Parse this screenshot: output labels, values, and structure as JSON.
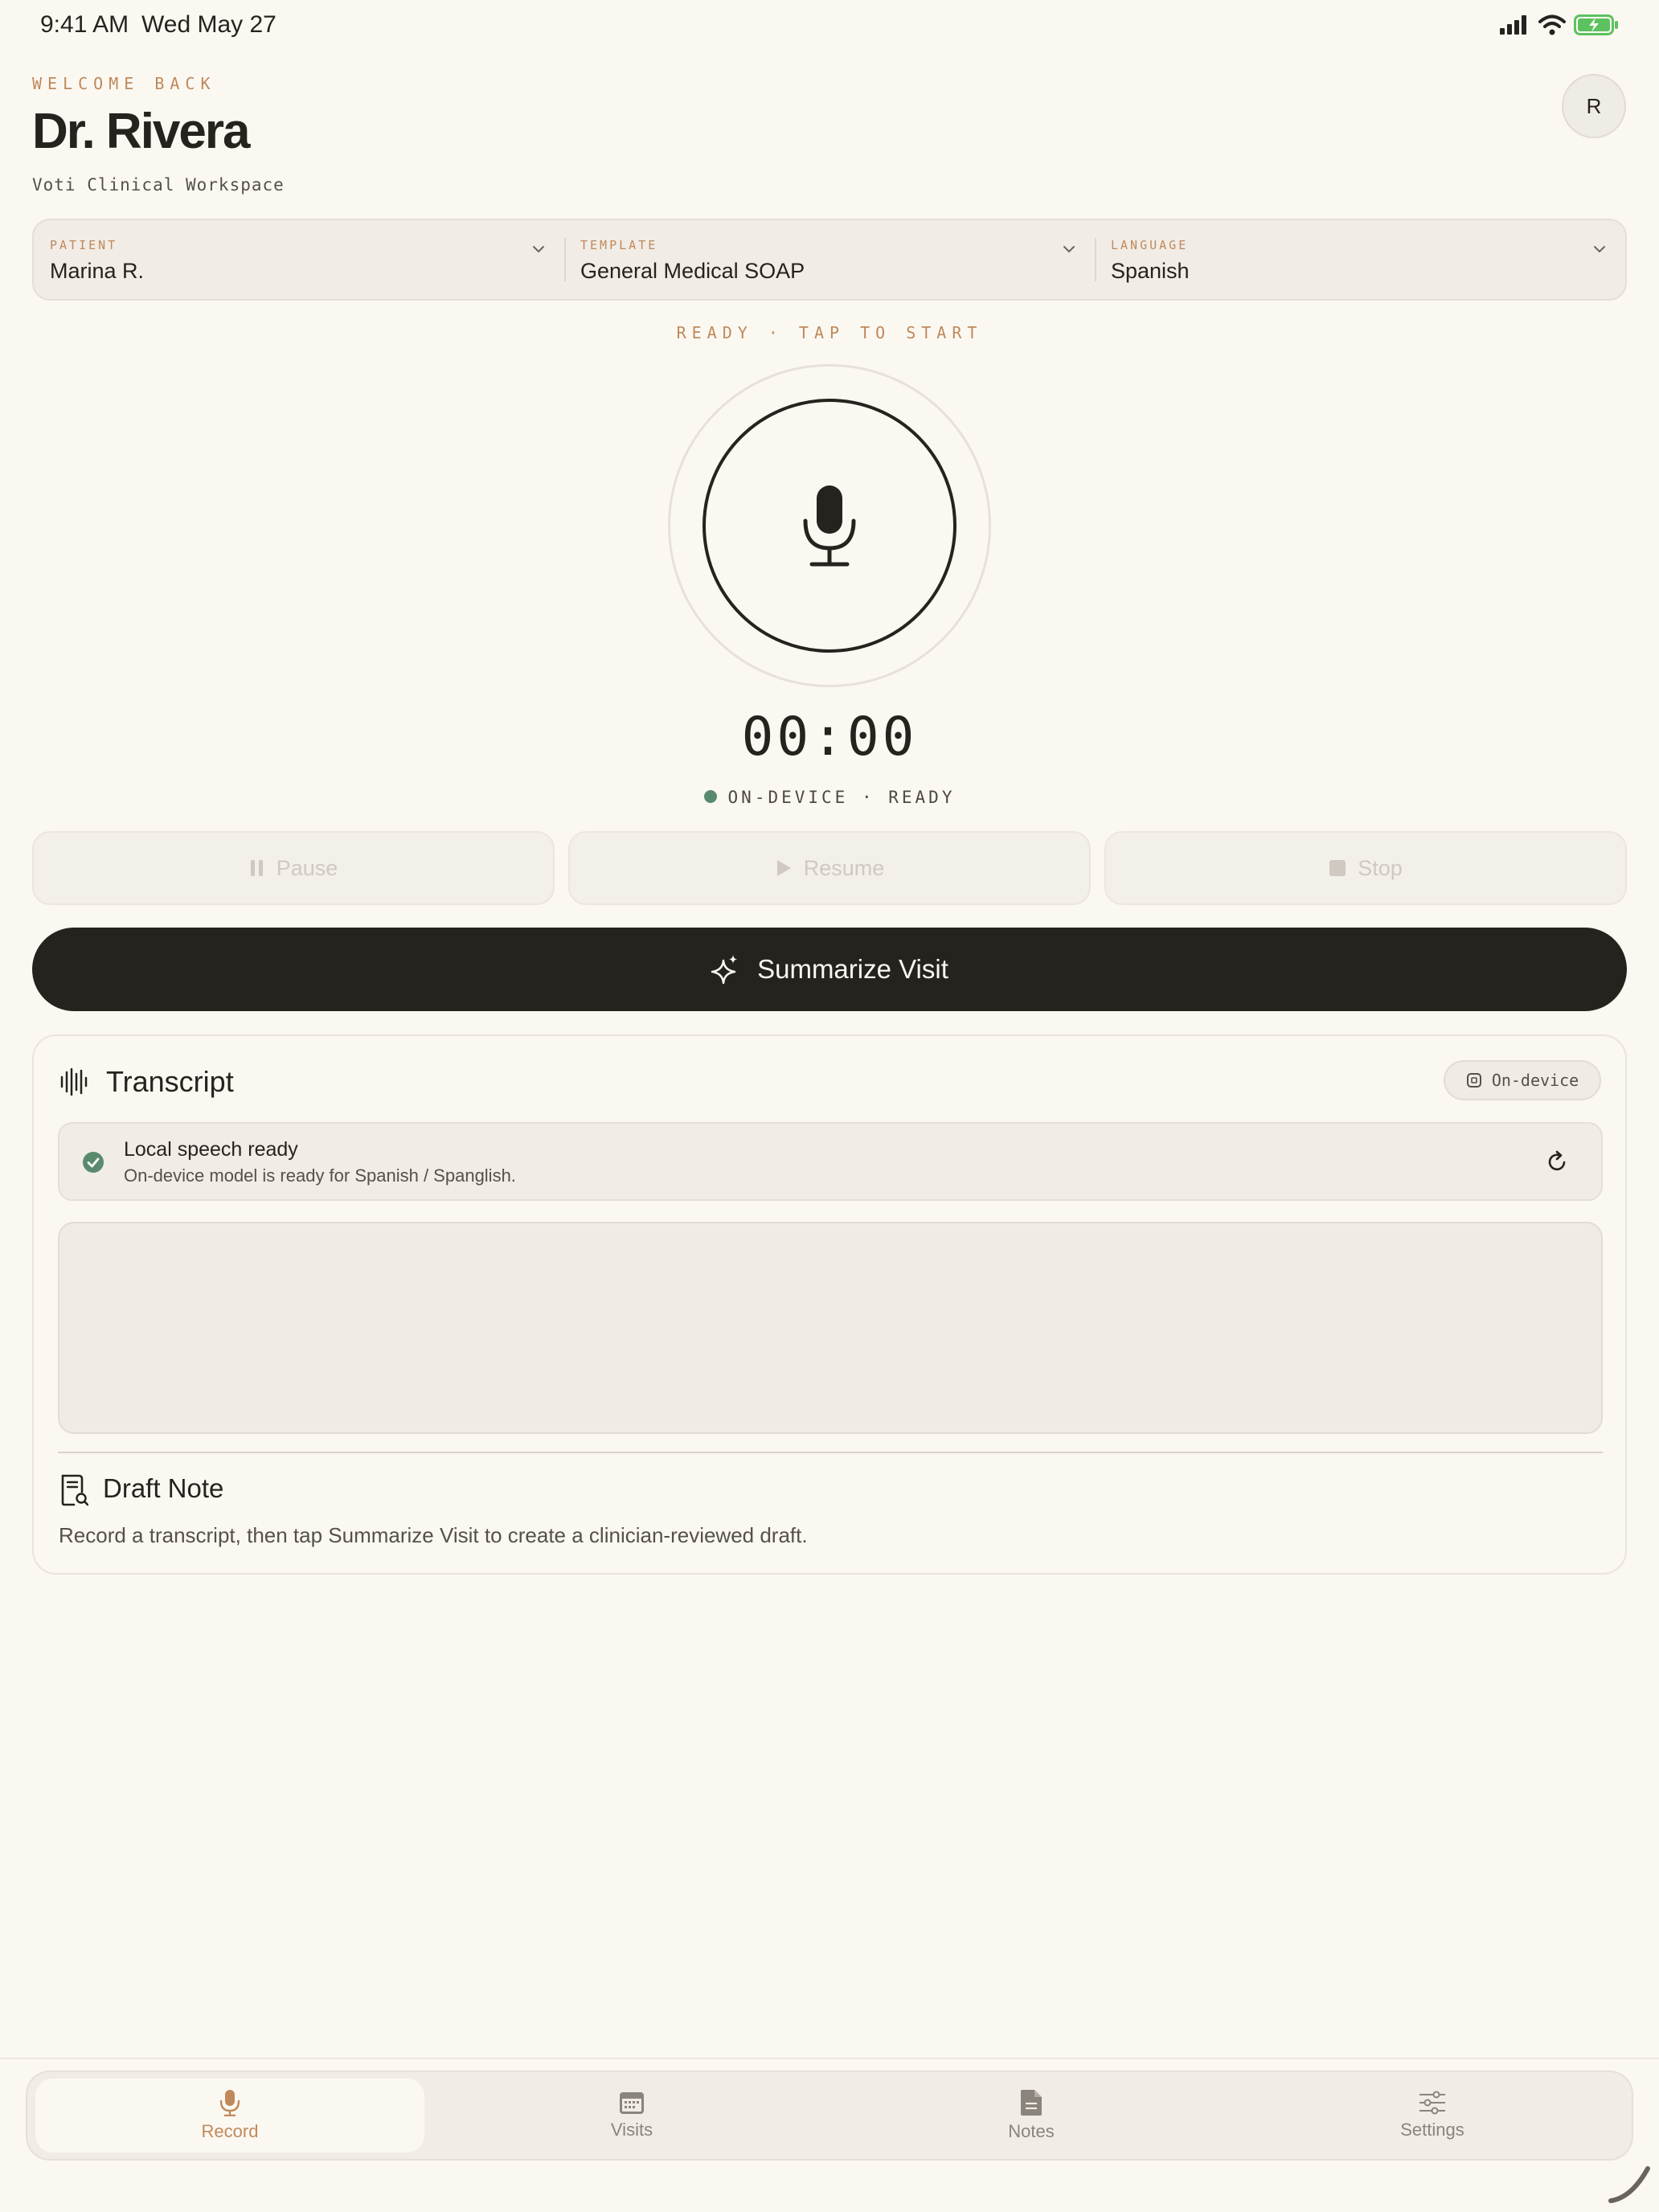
{
  "status_bar": {
    "time": "9:41 AM",
    "date": "Wed May 27"
  },
  "header": {
    "welcome": "WELCOME BACK",
    "name": "Dr. Rivera",
    "subtitle": "Voti Clinical Workspace",
    "avatar_initial": "R"
  },
  "selectors": [
    {
      "label": "PATIENT",
      "value": "Marina R."
    },
    {
      "label": "TEMPLATE",
      "value": "General Medical SOAP"
    },
    {
      "label": "LANGUAGE",
      "value": "Spanish"
    }
  ],
  "recorder": {
    "prompt": "READY · TAP TO START",
    "timer": "00:00",
    "engine_status": "ON-DEVICE · READY",
    "status_color": "#5a8a6e"
  },
  "controls": {
    "pause": "Pause",
    "resume": "Resume",
    "stop": "Stop"
  },
  "summarize": {
    "label": "Summarize Visit"
  },
  "transcript": {
    "title": "Transcript",
    "badge": "On-device",
    "status_title": "Local speech ready",
    "status_sub": "On-device model is ready for Spanish / Spanglish.",
    "text": ""
  },
  "draft": {
    "title": "Draft Note",
    "text": "Record a transcript, then tap Summarize Visit to create a clinician-reviewed draft."
  },
  "tabs": [
    {
      "label": "Record",
      "icon": "mic-icon",
      "active": true
    },
    {
      "label": "Visits",
      "icon": "calendar-icon",
      "active": false
    },
    {
      "label": "Notes",
      "icon": "document-icon",
      "active": false
    },
    {
      "label": "Settings",
      "icon": "sliders-icon",
      "active": false
    }
  ],
  "colors": {
    "accent": "#c0895a",
    "dark": "#26231f",
    "background": "#fbf8f2",
    "success": "#5a8a6e"
  }
}
